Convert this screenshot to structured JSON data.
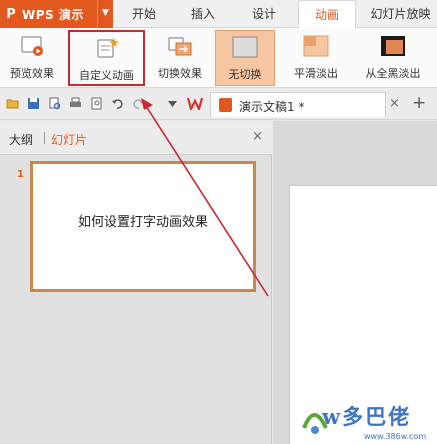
{
  "app": {
    "logo_glyph": "P",
    "name": "WPS 演示",
    "dropdown_glyph": "▼",
    "accent": "#e3581f"
  },
  "menu_tabs": [
    {
      "label": "开始"
    },
    {
      "label": "插入"
    },
    {
      "label": "设计"
    },
    {
      "label": "动画",
      "active": true
    },
    {
      "label": "幻灯片放映"
    }
  ],
  "ribbon": {
    "buttons": [
      {
        "label": "预览效果",
        "icon": "preview-effect-icon"
      },
      {
        "label": "自定义动画",
        "icon": "custom-animation-icon",
        "highlighted": true
      },
      {
        "label": "切换效果",
        "icon": "transition-effect-icon"
      },
      {
        "label": "无切换",
        "icon": "no-transition-icon",
        "selected": true
      },
      {
        "label": "平滑淡出",
        "icon": "smooth-fade-icon"
      },
      {
        "label": "从全黑淡出",
        "icon": "fade-from-black-icon"
      }
    ],
    "highlight_color": "#c8282e"
  },
  "quick_access": {
    "icons": [
      "open-folder-icon",
      "save-icon",
      "print-preview-icon",
      "print-icon",
      "preview-icon",
      "undo-icon",
      "redo-icon",
      "dropdown-icon",
      "wps-logo-icon"
    ],
    "document_tab": {
      "title": "演示文稿1 *",
      "close_glyph": "×"
    },
    "add_tab_glyph": "+"
  },
  "left_panel": {
    "tabs": [
      {
        "label": "大纲"
      },
      {
        "label": "幻灯片",
        "active": true
      }
    ],
    "close_glyph": "×",
    "slides": [
      {
        "number": "1",
        "text": "如何设置打字动画效果"
      }
    ]
  },
  "watermark": {
    "text": "w多巴佬",
    "url": "www.386w.com"
  }
}
